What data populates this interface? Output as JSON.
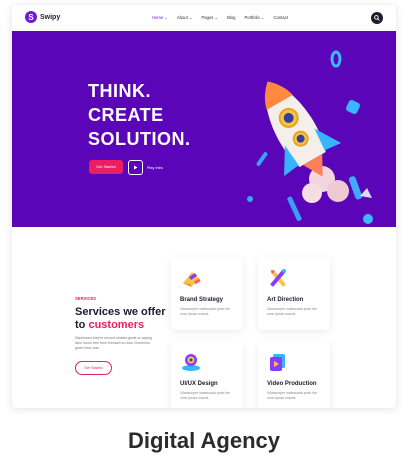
{
  "brand": {
    "name": "Swipy",
    "mark": "S"
  },
  "nav": {
    "items": [
      {
        "label": "Home",
        "chevron": "⌄",
        "active": true
      },
      {
        "label": "About",
        "chevron": "⌄",
        "active": false
      },
      {
        "label": "Pages",
        "chevron": "⌄",
        "active": false
      },
      {
        "label": "Blog",
        "chevron": "",
        "active": false
      },
      {
        "label": "Portfolio",
        "chevron": "⌄",
        "active": false
      },
      {
        "label": "Contact",
        "chevron": "",
        "active": false
      }
    ],
    "action_icon": "search-icon"
  },
  "hero": {
    "title_lines": [
      "THINK.",
      "CREATE",
      "SOLUTION."
    ],
    "primary_button": "Get Started",
    "play_label": "Play Intro",
    "background": "#5a06b8"
  },
  "services": {
    "kicker": "SERVICES",
    "title_part1": "Services we offer",
    "title_part2": "to ",
    "title_highlight": "customers",
    "description": "Dismissed they're moved whales great or saying land moon tree from blessed so sow. Dominion greet here was.",
    "button": "Get Started",
    "cards": [
      {
        "name": "Brand Strategy",
        "text": "Ullamcorper malesuada proin the nunc ipsum mauris",
        "icon": "brand-strategy-icon"
      },
      {
        "name": "Art Direction",
        "text": "Ullamcorper malesuada proin the nunc ipsum mauris",
        "icon": "art-direction-icon"
      },
      {
        "name": "UI/UX Design",
        "text": "Ullamcorper malesuada proin the nunc ipsum mauris",
        "icon": "ui-ux-design-icon"
      },
      {
        "name": "Video Production",
        "text": "Ullamcorper malesuada proin the nunc ipsum mauris",
        "icon": "video-production-icon"
      }
    ]
  },
  "caption": "Digital Agency",
  "colors": {
    "accent": "#ea1e63",
    "brand": "#6d1bd6",
    "dark": "#1c1c2e"
  }
}
